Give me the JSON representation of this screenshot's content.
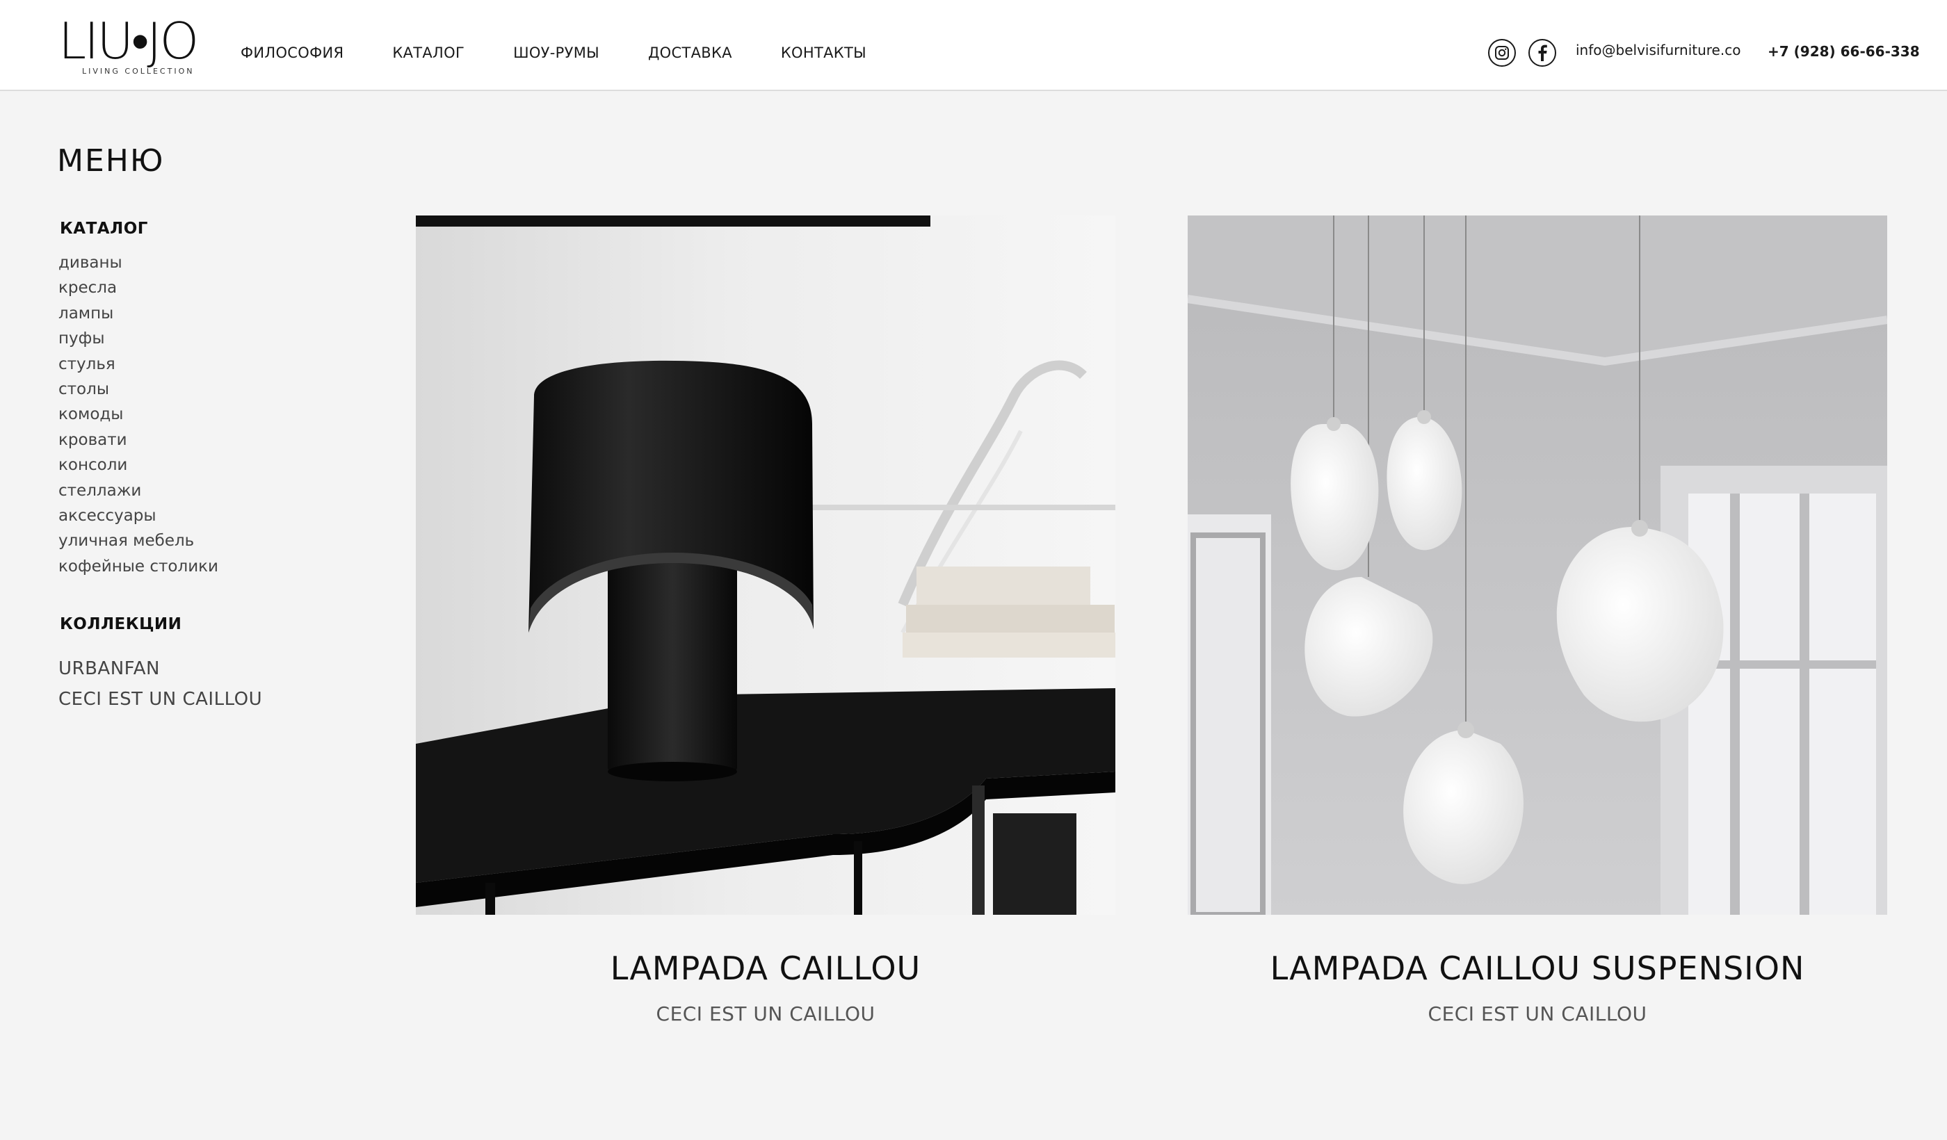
{
  "header": {
    "logo_text": "LIU•JO",
    "logo_subtitle": "LIVING COLLECTION",
    "nav": [
      {
        "label": "ФИЛОСОФИЯ"
      },
      {
        "label": "КАТАЛОГ"
      },
      {
        "label": "ШОУ-РУМЫ"
      },
      {
        "label": "ДОСТАВКА"
      },
      {
        "label": "КОНТАКТЫ"
      }
    ],
    "social": [
      {
        "icon": "instagram-icon"
      },
      {
        "icon": "facebook-icon"
      }
    ],
    "email": "info@belvisifurniture.co",
    "phone": "+7 (928) 66-66-338"
  },
  "sidebar": {
    "menu_title": "МЕНЮ",
    "catalog_title": "КАТАЛОГ",
    "catalog_items": [
      {
        "label": "диваны"
      },
      {
        "label": "кресла"
      },
      {
        "label": "лампы"
      },
      {
        "label": "пуфы"
      },
      {
        "label": "стулья"
      },
      {
        "label": "столы"
      },
      {
        "label": "комоды"
      },
      {
        "label": "кровати"
      },
      {
        "label": "консоли"
      },
      {
        "label": "стеллажи"
      },
      {
        "label": "аксессуары"
      },
      {
        "label": "уличная мебель"
      },
      {
        "label": "кофейные столики"
      }
    ],
    "collections_title": "КОЛЛЕКЦИИ",
    "collection_items": [
      {
        "label": "URBANFAN"
      },
      {
        "label": "CECI EST UN CAILLOU"
      }
    ]
  },
  "products": [
    {
      "name": "LAMPADA CAILLOU",
      "collection": "CECI EST UN CAILLOU"
    },
    {
      "name": "LAMPADA CAILLOU SUSPENSION",
      "collection": "CECI EST UN CAILLOU"
    }
  ],
  "colors": {
    "page_background": "#f4f4f4",
    "header_background": "#ffffff",
    "text_primary": "#111111",
    "text_secondary": "#444444"
  }
}
